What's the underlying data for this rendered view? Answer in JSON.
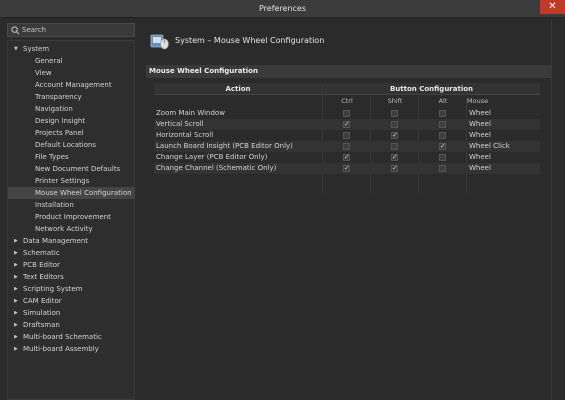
{
  "window": {
    "title": "Preferences",
    "close": "✕"
  },
  "search": {
    "placeholder": "Search"
  },
  "tree": {
    "system": "System",
    "children": [
      "General",
      "View",
      "Account Management",
      "Transparency",
      "Navigation",
      "Design Insight",
      "Projects Panel",
      "Default Locations",
      "File Types",
      "New Document Defaults",
      "Printer Settings",
      "Mouse Wheel Configuration",
      "Installation",
      "Product Improvement",
      "Network Activity"
    ],
    "selected_child": "Mouse Wheel Configuration",
    "groups": [
      "Data Management",
      "Schematic",
      "PCB Editor",
      "Text Editors",
      "Scripting System",
      "CAM Editor",
      "Simulation",
      "Draftsman",
      "Multi-board Schematic",
      "Multi-board Assembly"
    ]
  },
  "header": {
    "title": "System – Mouse Wheel Configuration",
    "icon": "mouse-wheel-config-icon"
  },
  "section": {
    "title": "Mouse Wheel Configuration"
  },
  "table": {
    "col_action": "Action",
    "col_buttons": "Button Configuration",
    "sub_ctrl": "Ctrl",
    "sub_shift": "Shift",
    "sub_alt": "Alt",
    "sub_mouse": "Mouse",
    "rows": [
      {
        "action": "Zoom Main Window",
        "ctrl": false,
        "shift": false,
        "alt": false,
        "mouse": "Wheel"
      },
      {
        "action": "Vertical Scroll",
        "ctrl": true,
        "shift": false,
        "alt": false,
        "mouse": "Wheel"
      },
      {
        "action": "Horizontal Scroll",
        "ctrl": false,
        "shift": true,
        "alt": false,
        "mouse": "Wheel"
      },
      {
        "action": "Launch Board Insight  (PCB Editor Only)",
        "ctrl": false,
        "shift": false,
        "alt": true,
        "mouse": "Wheel Click"
      },
      {
        "action": "Change Layer  (PCB Editor Only)",
        "ctrl": true,
        "shift": true,
        "alt": false,
        "mouse": "Wheel"
      },
      {
        "action": "Change Channel  (Schematic Only)",
        "ctrl": true,
        "shift": true,
        "alt": false,
        "mouse": "Wheel"
      }
    ]
  }
}
